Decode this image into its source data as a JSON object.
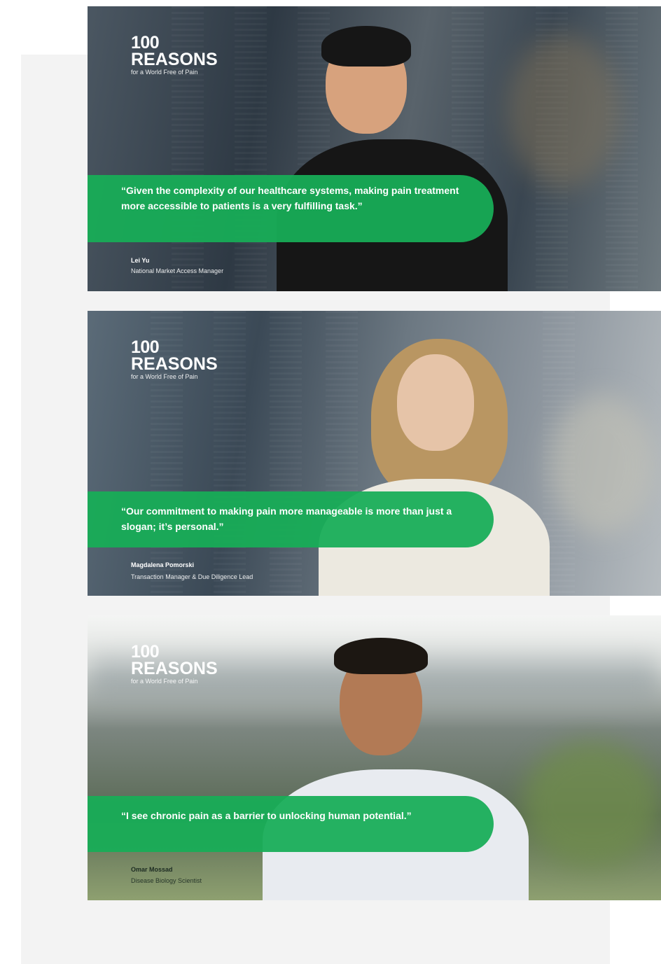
{
  "logo": {
    "number": "100",
    "word": "REASONS",
    "tagline": "for a World Free of Pain"
  },
  "testimonials": [
    {
      "quote": "“Given the complexity of our healthcare systems, making pain treatment more accessible to patients is a very fulfilling task.”",
      "name": "Lei Yu",
      "role": "National Market Access Manager"
    },
    {
      "quote": "“Our commitment to making pain more manageable is more than just a slogan; it’s personal.”",
      "name": "Magdalena Pomorski",
      "role": "Transaction Manager & Due Diligence Lead"
    },
    {
      "quote": "“I see chronic pain as a barrier to unlocking human potential.”",
      "name": "Omar Mossad",
      "role": "Disease Biology Scientist"
    }
  ],
  "colors": {
    "accent": "#17ad57",
    "panel": "#f3f3f3"
  }
}
